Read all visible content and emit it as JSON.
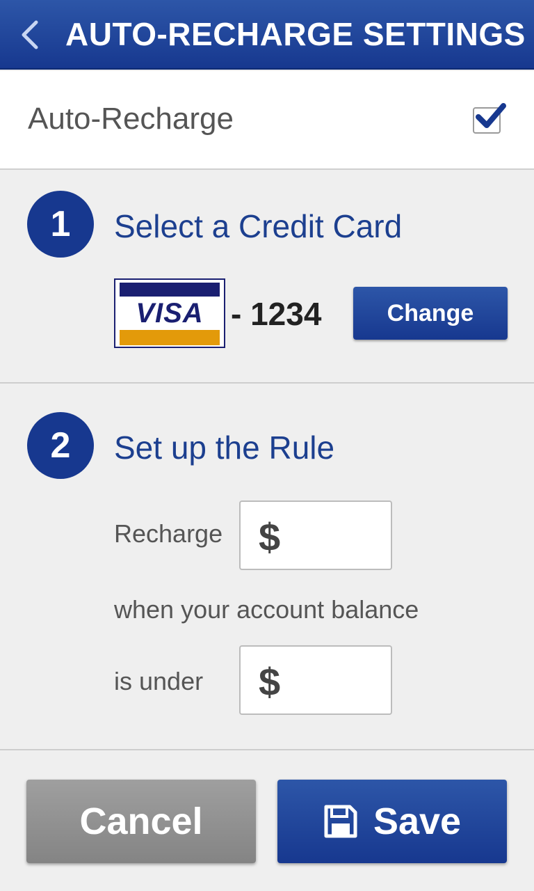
{
  "header": {
    "title": "AUTO-RECHARGE SETTINGS",
    "back_icon": "chevron-left-icon"
  },
  "auto_recharge": {
    "label": "Auto-Recharge",
    "checked": true
  },
  "step1": {
    "number": "1",
    "title": "Select a Credit Card",
    "card_brand": "VISA",
    "card_suffix": "- 1234",
    "change_label": "Change"
  },
  "step2": {
    "number": "2",
    "title": "Set up the Rule",
    "recharge_label": "Recharge",
    "currency_symbol": "$",
    "middle_text": "when your account balance",
    "under_label": "is under",
    "recharge_amount": "",
    "threshold_amount": ""
  },
  "actions": {
    "cancel_label": "Cancel",
    "save_label": "Save",
    "save_icon": "floppy-disk-icon"
  },
  "colors": {
    "primary": "#17388f",
    "accent_orange": "#e39a0a",
    "cancel_gray": "#8f8f8f"
  }
}
